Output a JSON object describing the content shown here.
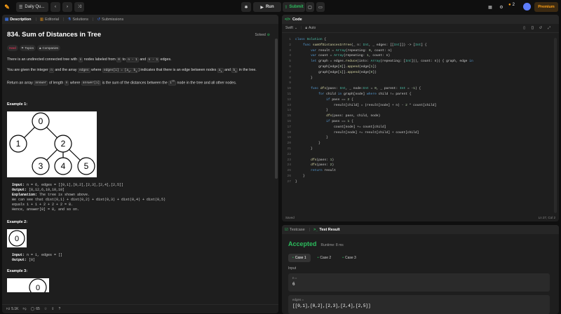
{
  "topbar": {
    "problem_list": "Daily Qu...",
    "run": "Run",
    "submit": "Submit",
    "streak": "2",
    "premium": "Premium"
  },
  "desc_panel": {
    "tabs": [
      "Description",
      "Editorial",
      "Solutions",
      "Submissions"
    ]
  },
  "problem": {
    "title": "834. Sum of Distances in Tree",
    "solved": "Solved",
    "difficulty": "Hard",
    "topics": "Topics",
    "companies": "Companies",
    "p1": {
      "a": "There is an undirected connected tree with ",
      "n": "n",
      "b": " nodes labeled from ",
      "zero": "0",
      "c": " to ",
      "nm1": "n - 1",
      "d": " and ",
      "nm1b": "n - 1",
      "e": " edges."
    },
    "p2": {
      "a": "You are given the integer ",
      "n": "n",
      "b": " and the array ",
      "edges": "edges",
      "c": " where ",
      "edgesi": "edges[i] = [a",
      "d": "] indicates that there is an edge between nodes ",
      "ai": "a",
      "e": " and ",
      "bi": "b",
      "f": " in the tree."
    },
    "p3": {
      "a": "Return an array ",
      "answer": "answer",
      "b": " of length ",
      "n": "n",
      "c": " where ",
      "answeri": "answer[i]",
      "d": " is the sum of the distances between the ",
      "ith": "i",
      "e": " node in the tree and all other nodes."
    },
    "ex1": {
      "label": "Example 1:",
      "input_l": "Input:",
      "input": " n = 6, edges = [[0,1],[0,2],[2,3],[2,4],[2,5]]",
      "output_l": "Output:",
      "output": " [8,12,6,10,10,10]",
      "expl_l": "Explanation:",
      "expl": " The tree is shown above.",
      "l1": "We can see that dist(0,1) + dist(0,2) + dist(0,3) + dist(0,4) + dist(0,5)",
      "l2": "equals 1 + 1 + 2 + 2 + 2 = 8.",
      "l3": "Hence, answer[0] = 8, and so on."
    },
    "ex2": {
      "label": "Example 2:",
      "input_l": "Input:",
      "input": " n = 1, edges = []",
      "output_l": "Output:",
      "output": " [0]"
    },
    "ex3": {
      "label": "Example 3:"
    },
    "nodes": [
      "0",
      "1",
      "2",
      "3",
      "4",
      "5"
    ],
    "likes": "5.1K",
    "comments": "65"
  },
  "code_panel": {
    "title": "Code",
    "lang": "Swift",
    "auto": "Auto",
    "saved": "Saved",
    "cursor": "Ln 27, Col 2"
  },
  "code_lines": [
    "class Solution {",
    "    func sumOfDistancesInTree(_ n: Int, _ edges: [[Int]]) -> [Int] {",
    "        var result = Array(repeating: 0, count: n)",
    "        var count = Array(repeating: 1, count: n)",
    "        let graph = edges.reduce(into: Array(repeating: [Int](), count: n)) { graph, edge in",
    "            graph[edge[0]].append(edge[1])",
    "            graph[edge[1]].append(edge[0])",
    "        }",
    "",
    "        func dfs(pass: Int, _ node:Int = 0, _ parent: Int = -1) {",
    "            for child in graph[node] where child != parent {",
    "                if pass == 2 {",
    "                    result[child] = (result[node] + n) - 2 * count[child]",
    "                }",
    "                dfs(pass: pass, child, node)",
    "                if pass == 1 {",
    "                    count[node] += count[child]",
    "                    result[node] += result[child] + count[child]",
    "                }",
    "            }",
    "        }",
    "",
    "        dfs(pass: 1)",
    "        dfs(pass: 2)",
    "        return result",
    "    }",
    "}"
  ],
  "tests": {
    "tab1": "Testcase",
    "tab2": "Test Result",
    "status": "Accepted",
    "runtime": "Runtime: 8 ms",
    "cases": [
      "Case 1",
      "Case 2",
      "Case 3"
    ],
    "input_label": "Input",
    "n_label": "n =",
    "n_value": "6",
    "edges_label": "edges =",
    "edges_value": "[[0,1],[0,2],[2,3],[2,4],[2,5]]"
  }
}
